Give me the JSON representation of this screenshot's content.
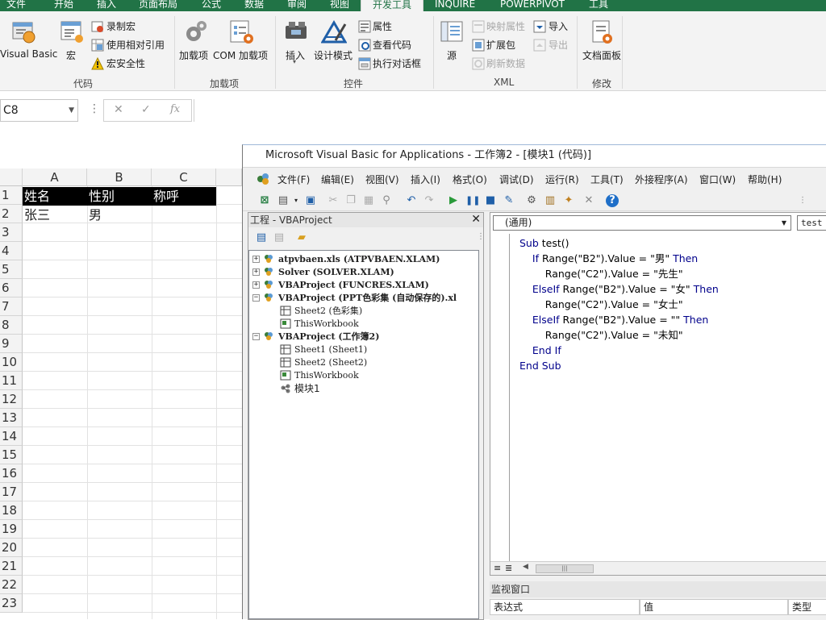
{
  "ribbon": {
    "tabs": [
      "文件",
      "开始",
      "插入",
      "页面布局",
      "公式",
      "数据",
      "审阅",
      "视图",
      "开发工具",
      "INQUIRE",
      "POWERPIVOT",
      "工具"
    ],
    "active_tab": "开发工具",
    "code_group": {
      "visual_basic": "Visual Basic",
      "macros": "宏",
      "record_macro": "录制宏",
      "relative_ref": "使用相对引用",
      "macro_security": "宏安全性",
      "label": "代码"
    },
    "addins_group": {
      "addins": "加载项",
      "com_addins": "COM 加载项",
      "label": "加载项"
    },
    "controls_group": {
      "insert": "插入",
      "design_mode": "设计模式",
      "properties": "属性",
      "view_code": "查看代码",
      "run_dialog": "执行对话框",
      "label": "控件"
    },
    "xml_group": {
      "source": "源",
      "map_properties": "映射属性",
      "expansion_packs": "扩展包",
      "refresh_data": "刷新数据",
      "import": "导入",
      "export": "导出",
      "label": "XML"
    },
    "modify_group": {
      "document_panel": "文档面板",
      "label": "修改"
    }
  },
  "formula_bar": {
    "name_box": "C8",
    "cancel": "✕",
    "enter": "✓",
    "fx": "fx",
    "value": ""
  },
  "sheet": {
    "columns": [
      "A",
      "B",
      "C"
    ],
    "rows": [
      "1",
      "2",
      "3",
      "4",
      "5",
      "6",
      "7",
      "8",
      "9",
      "10",
      "11",
      "12",
      "13",
      "14",
      "15",
      "16",
      "17",
      "18",
      "19",
      "20",
      "21",
      "22",
      "23"
    ],
    "cells": {
      "A1": "姓名",
      "B1": "性别",
      "C1": "称呼",
      "A2": "张三",
      "B2": "男"
    }
  },
  "vbe": {
    "title": "Microsoft Visual Basic for Applications - 工作簿2 - [模块1 (代码)]",
    "menu": [
      "文件(F)",
      "编辑(E)",
      "视图(V)",
      "插入(I)",
      "格式(O)",
      "调试(D)",
      "运行(R)",
      "工具(T)",
      "外接程序(A)",
      "窗口(W)",
      "帮助(H)"
    ],
    "project": {
      "title": "工程 - VBAProject",
      "close": "✕",
      "nodes": [
        "atpvbaen.xls (ATPVBAEN.XLAM)",
        "Solver (SOLVER.XLAM)",
        "VBAProject (FUNCRES.XLAM)",
        "VBAProject (PPT色彩集 (自动保存的).xl",
        "Sheet2 (色彩集)",
        "ThisWorkbook",
        "VBAProject (工作簿2)",
        "Sheet1 (Sheet1)",
        "Sheet2 (Sheet2)",
        "ThisWorkbook",
        "模块1"
      ]
    },
    "code": {
      "object_combo": "(通用)",
      "proc_combo": "test",
      "lines": [
        {
          "indent": "",
          "parts": [
            [
              "kw",
              "Sub "
            ],
            [
              "t",
              "test()"
            ]
          ]
        },
        {
          "indent": "    ",
          "parts": [
            [
              "kw",
              "If "
            ],
            [
              "t",
              "Range(\"B2\").Value = \"男\" "
            ],
            [
              "kw",
              "Then"
            ]
          ]
        },
        {
          "indent": "        ",
          "parts": [
            [
              "t",
              "Range(\"C2\").Value = \"先生\""
            ]
          ]
        },
        {
          "indent": "    ",
          "parts": [
            [
              "kw",
              "ElseIf "
            ],
            [
              "t",
              "Range(\"B2\").Value = \"女\" "
            ],
            [
              "kw",
              "Then"
            ]
          ]
        },
        {
          "indent": "        ",
          "parts": [
            [
              "t",
              "Range(\"C2\").Value = \"女士\""
            ]
          ]
        },
        {
          "indent": "    ",
          "parts": [
            [
              "kw",
              "ElseIf "
            ],
            [
              "t",
              "Range(\"B2\").Value = \"\" "
            ],
            [
              "kw",
              "Then"
            ]
          ]
        },
        {
          "indent": "        ",
          "parts": [
            [
              "t",
              "Range(\"C2\").Value = \"未知\""
            ]
          ]
        },
        {
          "indent": "    ",
          "parts": [
            [
              "kw",
              "End If"
            ]
          ]
        },
        {
          "indent": "",
          "parts": [
            [
              "kw",
              "End Sub"
            ]
          ]
        }
      ]
    },
    "watch": {
      "title": "监视窗口",
      "col_expression": "表达式",
      "col_value": "值",
      "col_type": "类型"
    }
  },
  "colors": {
    "excel_green": "#217346",
    "vba_keyword": "#00008b"
  }
}
